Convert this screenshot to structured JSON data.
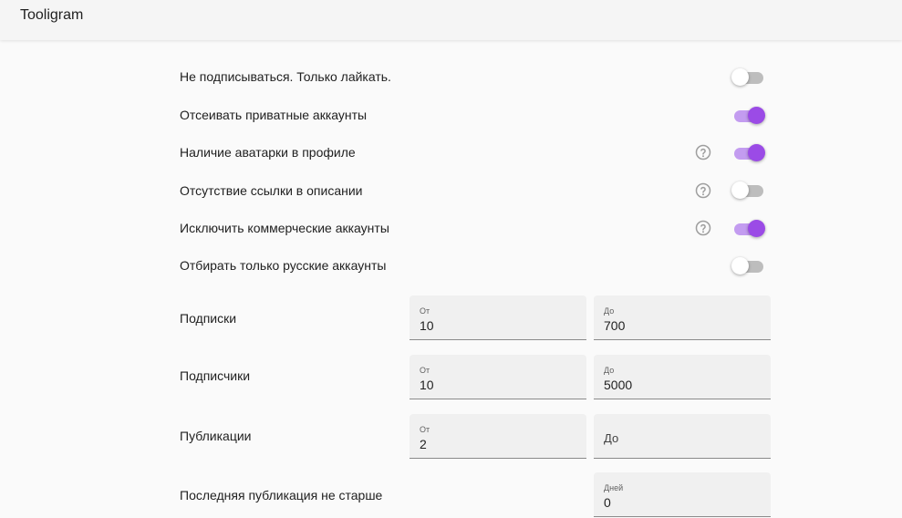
{
  "app": {
    "title": "Tooligram"
  },
  "toggles": [
    {
      "label": "Не подписываться. Только лайкать.",
      "on": false,
      "help": false
    },
    {
      "label": "Отсеивать приватные аккаунты",
      "on": true,
      "help": false
    },
    {
      "label": "Наличие аватарки в профиле",
      "on": true,
      "help": true
    },
    {
      "label": "Отсутствие ссылки в описании",
      "on": false,
      "help": true
    },
    {
      "label": "Исключить коммерческие аккаунты",
      "on": true,
      "help": true
    },
    {
      "label": "Отбирать только русские аккаунты",
      "on": false,
      "help": false
    }
  ],
  "ranges": {
    "following": {
      "label": "Подписки",
      "from_label": "От",
      "from_value": "10",
      "to_label": "До",
      "to_value": "700"
    },
    "followers": {
      "label": "Подписчики",
      "from_label": "От",
      "from_value": "10",
      "to_label": "До",
      "to_value": "5000"
    },
    "posts": {
      "label": "Публикации",
      "from_label": "От",
      "from_value": "2",
      "to_label": "До",
      "to_value": ""
    }
  },
  "last_post": {
    "label": "Последняя публикация не старше",
    "days_label": "Дней",
    "days_value": "0"
  },
  "icons": {
    "help": "help-circle-outline-icon"
  },
  "colors": {
    "accent": "#9b4be6",
    "accent_track": "#c39cf0",
    "off_track": "#bdbdbd",
    "help_icon": "#9e9e9e"
  }
}
